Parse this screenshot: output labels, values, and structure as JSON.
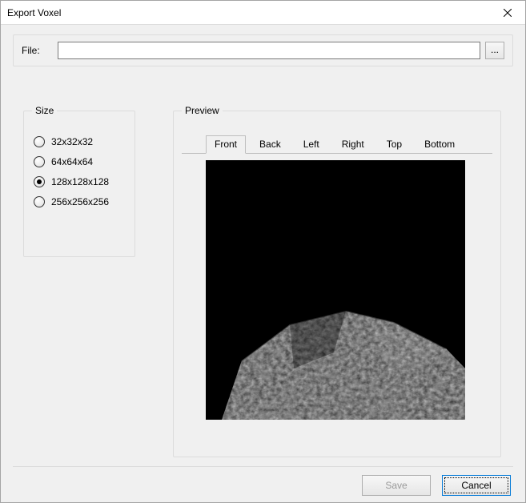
{
  "window": {
    "title": "Export Voxel"
  },
  "file": {
    "label": "File:",
    "value": "",
    "browse_label": "..."
  },
  "size": {
    "legend": "Size",
    "options": [
      {
        "label": "32x32x32",
        "selected": false
      },
      {
        "label": "64x64x64",
        "selected": false
      },
      {
        "label": "128x128x128",
        "selected": true
      },
      {
        "label": "256x256x256",
        "selected": false
      }
    ]
  },
  "preview": {
    "legend": "Preview",
    "tabs": [
      {
        "label": "Front",
        "active": true
      },
      {
        "label": "Back",
        "active": false
      },
      {
        "label": "Left",
        "active": false
      },
      {
        "label": "Right",
        "active": false
      },
      {
        "label": "Top",
        "active": false
      },
      {
        "label": "Bottom",
        "active": false
      }
    ]
  },
  "footer": {
    "save_label": "Save",
    "cancel_label": "Cancel",
    "save_enabled": false
  }
}
